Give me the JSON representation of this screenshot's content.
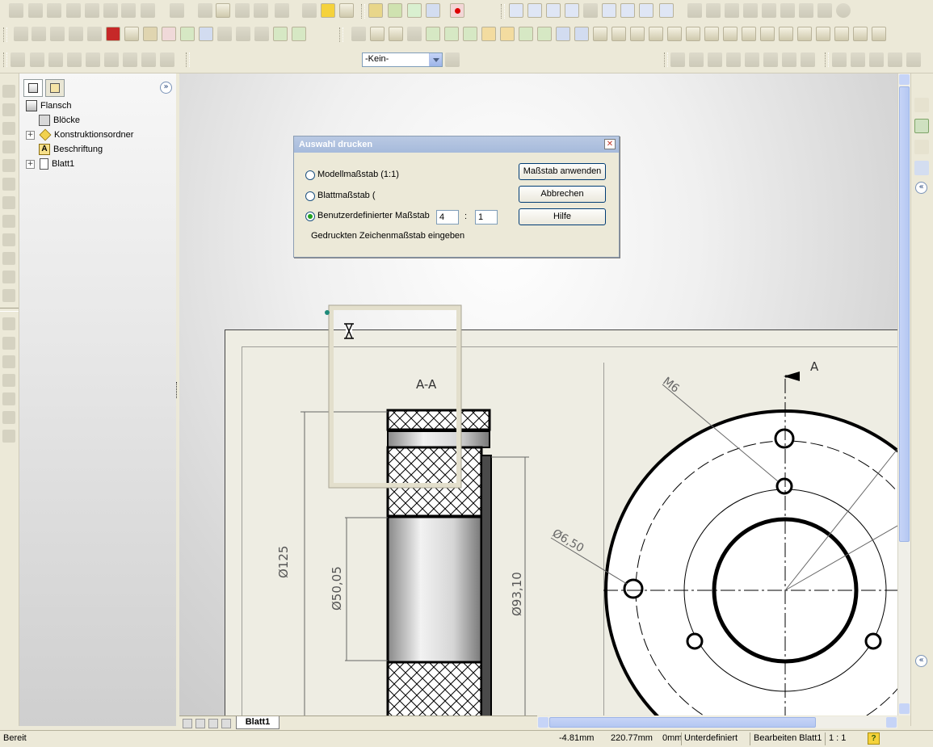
{
  "dialog": {
    "title": "Auswahl drucken",
    "close_glyph": "✕",
    "options": [
      {
        "label": "Modellmaßstab (1:1)",
        "selected": false
      },
      {
        "label": "Blattmaßstab (",
        "selected": false
      },
      {
        "label": "Benutzerdefinierter Maßstab",
        "selected": true
      }
    ],
    "scale_numerator": "4",
    "scale_separator": ":",
    "scale_denominator": "1",
    "hint": "Gedruckten Zeichenmaßstab eingeben",
    "buttons": {
      "apply": "Maßstab anwenden",
      "cancel": "Abbrechen",
      "help": "Hilfe"
    }
  },
  "toolbar": {
    "layer_select": "-Kein-"
  },
  "tree": {
    "root": "Flansch",
    "items": [
      {
        "label": "Blöcke",
        "expander": "",
        "icon": "blocks-icon"
      },
      {
        "label": "Konstruktionsordner",
        "expander": "+",
        "icon": "folder-diamond-icon"
      },
      {
        "label": "Beschriftung",
        "expander": "",
        "icon": "annotation-icon"
      },
      {
        "label": "Blatt1",
        "expander": "+",
        "icon": "sheet-icon"
      }
    ]
  },
  "drawing": {
    "section_label": "A-A",
    "section_arrow_label": "A",
    "dim_d125": "Ø125",
    "dim_d5005": "Ø50,05",
    "dim_d9310": "Ø93,10",
    "dim_m6": "M6",
    "dim_d650": "Ø6,50"
  },
  "sheet_tab": "Blatt1",
  "status": {
    "left": "Bereit",
    "x": "-4.81mm",
    "y": "220.77mm",
    "z": "0mm",
    "state": "Unterdefiniert",
    "mode": "Bearbeiten Blatt1",
    "scale": "1 : 1",
    "help": "?"
  },
  "colors": {
    "title_bar": "#a6badb",
    "button_border": "#003c74",
    "radio_dot": "#21a121",
    "sheet": "#eeede3"
  }
}
